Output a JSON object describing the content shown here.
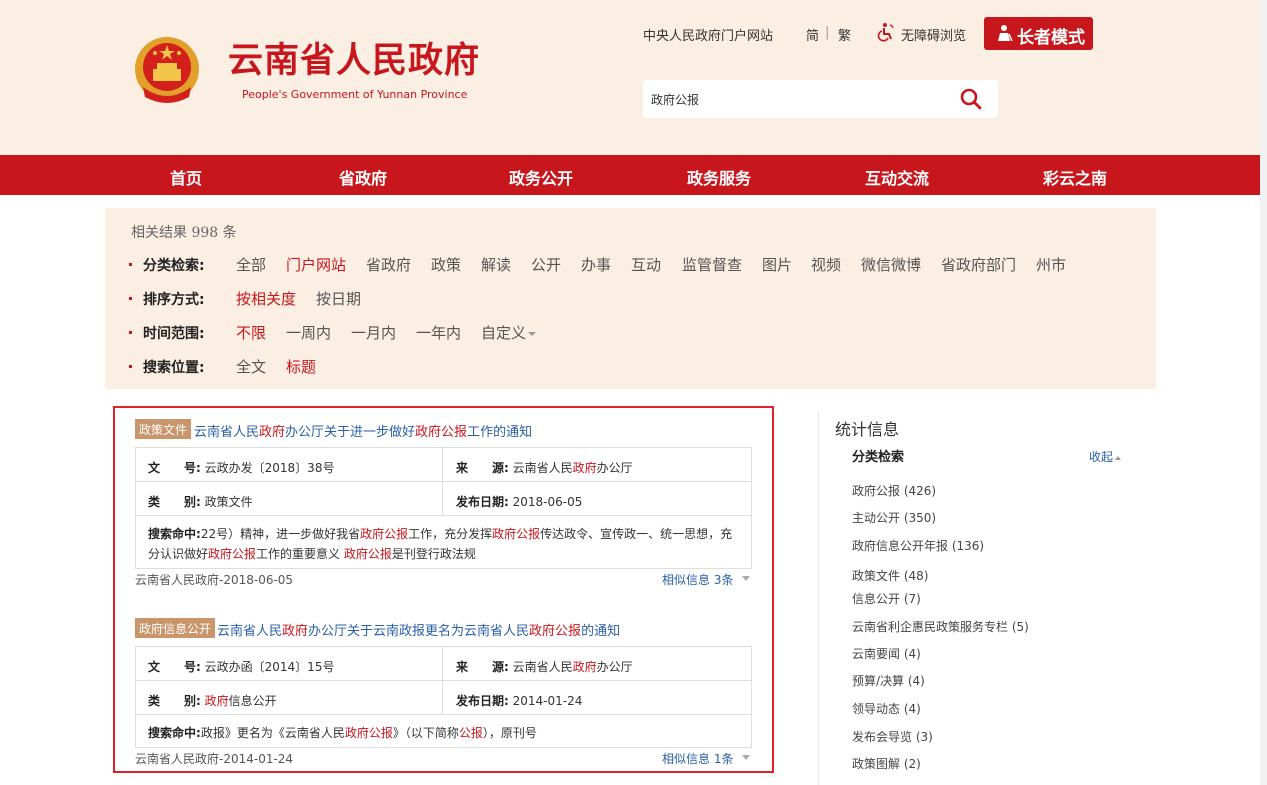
{
  "header": {
    "site_title": "云南省人民政府",
    "site_subtitle": "People's Government of Yunnan Province",
    "top_links": {
      "central_portal": "中央人民政府门户网站",
      "simplified": "简",
      "separator": "|",
      "traditional": "繁",
      "accessible": "无障碍浏览"
    },
    "elder_mode": "长者模式",
    "search": {
      "value": "政府公报",
      "icon": "search-icon"
    },
    "colors": {
      "brand_red": "#c8161d",
      "header_bg": "#fbeee2"
    }
  },
  "nav": {
    "items": [
      "首页",
      "省政府",
      "政务公开",
      "政务服务",
      "互动交流",
      "彩云之南"
    ]
  },
  "filters": {
    "result_count_prefix": "相关结果",
    "result_count": "998",
    "result_count_suffix": "条",
    "category": {
      "label": "分类检索:",
      "options": [
        "全部",
        "门户网站",
        "省政府",
        "政策",
        "解读",
        "公开",
        "办事",
        "互动",
        "监管督查",
        "图片",
        "视频",
        "微信微博",
        "省政府部门",
        "州市"
      ],
      "active": "门户网站"
    },
    "sort": {
      "label": "排序方式:",
      "options": [
        "按相关度",
        "按日期"
      ],
      "active": "按相关度"
    },
    "time": {
      "label": "时间范围:",
      "options": [
        "不限",
        "一周内",
        "一月内",
        "一年内",
        "自定义"
      ],
      "active": "不限"
    },
    "position": {
      "label": "搜索位置:",
      "options": [
        "全文",
        "标题"
      ],
      "active": "标题"
    }
  },
  "results": [
    {
      "tag": "政策文件",
      "title": {
        "p1": "云南省人民",
        "h1": "政府",
        "p2": "办公厅关于进一步做好",
        "h2": "政府公报",
        "p3": "工作的通知"
      },
      "doc_no_label": "文　　号:",
      "doc_no": "云政办发〔2018〕38号",
      "source_label": "来　　源:",
      "source": {
        "p1": "云南省人民",
        "h1": "政府",
        "p2": "办公厅"
      },
      "category_label": "类　　别:",
      "category": {
        "h1": "",
        "p1": "政策文件"
      },
      "date_label": "发布日期:",
      "date": "2018-06-05",
      "hit_label": "搜索命中:",
      "hit": {
        "p1": "22号）精神，进一步做好我省",
        "h1": "政府公报",
        "p2": "工作，充分发挥",
        "h2": "政府公报",
        "p3": "传达政令、宣传政一、统一思想，充分认识做好",
        "h3": "政府公报",
        "p4": "工作的重要意义 ",
        "h4": "政府公报",
        "p5": "是刊登行政法规"
      },
      "source_line": "云南省人民政府-2018-06-05",
      "similar_prefix": "相似信息 ",
      "similar_count": "3",
      "similar_suffix": "条"
    },
    {
      "tag": "政府信息公开",
      "title": {
        "p1": "云南省人民",
        "h1": "政府",
        "p2": "办公厅关于云南政报更名为云南省人民",
        "h2": "政府公报",
        "p3": "的通知"
      },
      "doc_no_label": "文　　号:",
      "doc_no": "云政办函〔2014〕15号",
      "source_label": "来　　源:",
      "source": {
        "p1": "云南省人民",
        "h1": "政府",
        "p2": "办公厅"
      },
      "category_label": "类　　别:",
      "category": {
        "h1": "政府",
        "p1": "信息公开"
      },
      "date_label": "发布日期:",
      "date": "2014-01-24",
      "hit_label": "搜索命中:",
      "hit": {
        "p1": "政报》更名为《云南省人民",
        "h1": "政府公报",
        "p2": "》（以下简称",
        "h2": "公报",
        "p3": "），原刊号",
        "h3": "",
        "p4": "",
        "h4": "",
        "p5": ""
      },
      "source_line": "云南省人民政府-2014-01-24",
      "similar_prefix": "相似信息 ",
      "similar_count": "1",
      "similar_suffix": "条"
    }
  ],
  "sidebar": {
    "title": "统计信息",
    "subtitle": "分类检索",
    "collapse": "收起",
    "items": [
      "政府公报 (426)",
      "主动公开 (350)",
      "政府信息公开年报 (136)",
      "政策文件 (48)",
      "信息公开 (7)",
      "云南省利企惠民政策服务专栏 (5)",
      "云南要闻 (4)",
      "预算/决算 (4)",
      "领导动态 (4)",
      "发布会导览 (3)",
      "政策图解 (2)"
    ]
  }
}
